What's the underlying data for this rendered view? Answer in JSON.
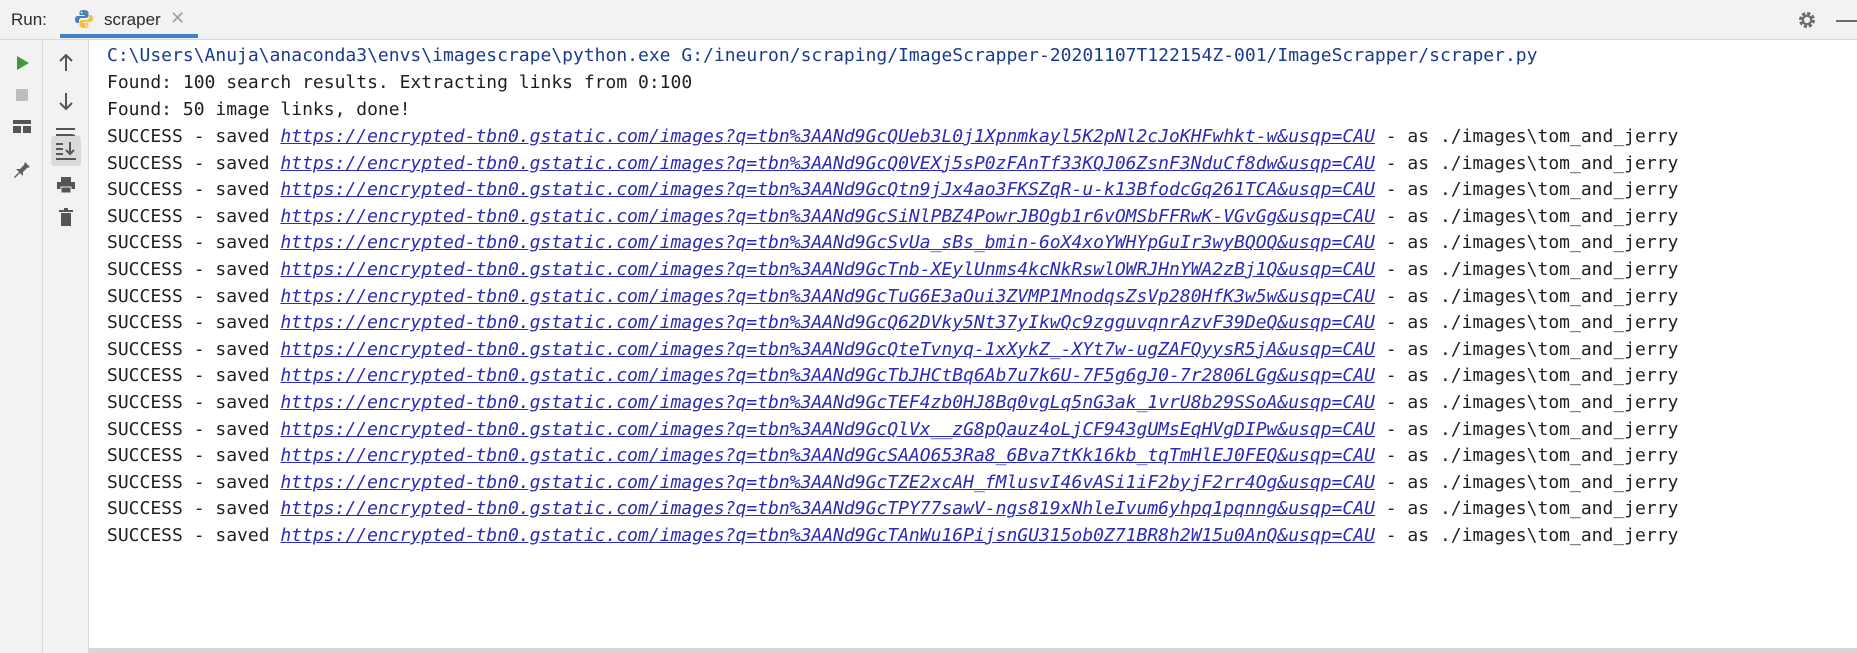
{
  "header": {
    "run_label": "Run:",
    "tab_label": "scraper"
  },
  "colors": {
    "accent": "#4083c9",
    "run_green": "#3e9a3e",
    "link_blue": "#2a2ab8"
  },
  "icons": {
    "left_toolbar": [
      "run-icon",
      "stop-icon",
      "layout-icon",
      "pin-icon"
    ],
    "right_toolbar": [
      "up-arrow-icon",
      "down-arrow-icon",
      "soft-wrap-icon",
      "scroll-to-end-icon",
      "print-icon",
      "trash-icon"
    ]
  },
  "console": {
    "command": "C:\\Users\\Anuja\\anaconda3\\envs\\imagescrape\\python.exe G:/ineuron/scraping/ImageScrapper-20201107T122154Z-001/ImageScrapper/scraper.py",
    "info_lines": [
      "Found: 100 search results. Extracting links from 0:100",
      "Found: 50 image links, done!"
    ],
    "success_prefix": "SUCCESS - saved ",
    "success_suffix": " - as ./images\\tom_and_jerry",
    "success_links": [
      "https://encrypted-tbn0.gstatic.com/images?q=tbn%3AANd9GcQUeb3L0j1Xpnmkayl5K2pNl2cJoKHFwhkt-w&usqp=CAU",
      "https://encrypted-tbn0.gstatic.com/images?q=tbn%3AANd9GcQ0VEXj5sP0zFAnTf33KQJ06ZsnF3NduCf8dw&usqp=CAU",
      "https://encrypted-tbn0.gstatic.com/images?q=tbn%3AANd9GcQtn9jJx4ao3FKSZqR-u-k13BfodcGq261TCA&usqp=CAU",
      "https://encrypted-tbn0.gstatic.com/images?q=tbn%3AANd9GcSiNlPBZ4PowrJBOgb1r6vOMSbFFRwK-VGvGg&usqp=CAU",
      "https://encrypted-tbn0.gstatic.com/images?q=tbn%3AANd9GcSvUa_sBs_bmin-6oX4xoYWHYpGuIr3wyBQOQ&usqp=CAU",
      "https://encrypted-tbn0.gstatic.com/images?q=tbn%3AANd9GcTnb-XEylUnms4kcNkRswlOWRJHnYWA2zBj1Q&usqp=CAU",
      "https://encrypted-tbn0.gstatic.com/images?q=tbn%3AANd9GcTuG6E3aOui3ZVMP1MnodqsZsVp280HfK3w5w&usqp=CAU",
      "https://encrypted-tbn0.gstatic.com/images?q=tbn%3AANd9GcQ62DVky5Nt37yIkwQc9zgguvqnrAzvF39DeQ&usqp=CAU",
      "https://encrypted-tbn0.gstatic.com/images?q=tbn%3AANd9GcQteTvnyq-1xXykZ_-XYt7w-ugZAFQyysR5jA&usqp=CAU",
      "https://encrypted-tbn0.gstatic.com/images?q=tbn%3AANd9GcTbJHCtBq6Ab7u7k6U-7F5g6gJ0-7r2806LGg&usqp=CAU",
      "https://encrypted-tbn0.gstatic.com/images?q=tbn%3AANd9GcTEF4zb0HJ8Bq0vgLq5nG3ak_1vrU8b29SSoA&usqp=CAU",
      "https://encrypted-tbn0.gstatic.com/images?q=tbn%3AANd9GcQlVx__zG8pQauz4oLjCF943gUMsEqHVgDIPw&usqp=CAU",
      "https://encrypted-tbn0.gstatic.com/images?q=tbn%3AANd9GcSAAO653Ra8_6Bva7tKk16kb_tqTmHlEJ0FEQ&usqp=CAU",
      "https://encrypted-tbn0.gstatic.com/images?q=tbn%3AANd9GcTZE2xcAH_fMlusvI46vASi1iF2byjF2rr4Og&usqp=CAU",
      "https://encrypted-tbn0.gstatic.com/images?q=tbn%3AANd9GcTPY77sawV-ngs819xNhleIvum6yhpq1pqnng&usqp=CAU",
      "https://encrypted-tbn0.gstatic.com/images?q=tbn%3AANd9GcTAnWu16PijsnGU315ob0Z71BR8h2W15u0AnQ&usqp=CAU"
    ]
  }
}
